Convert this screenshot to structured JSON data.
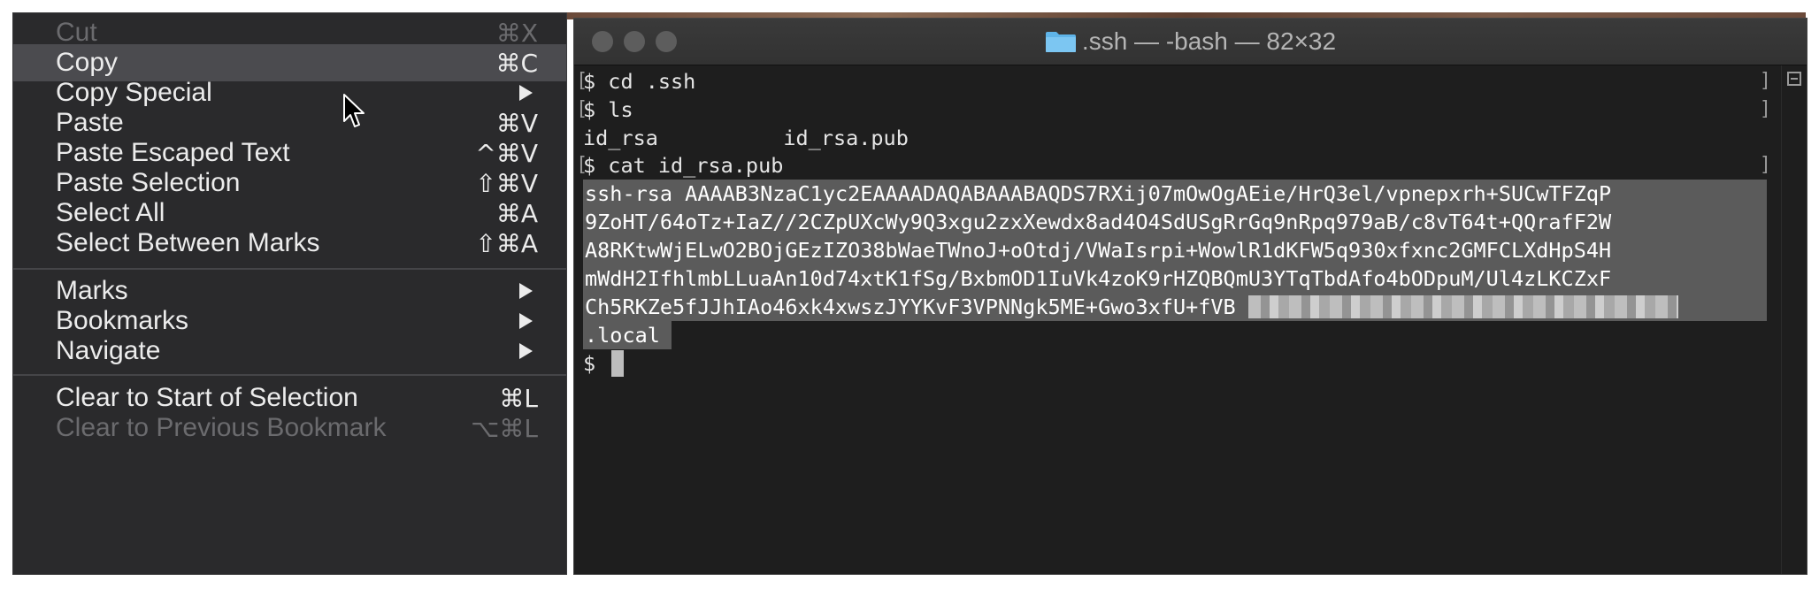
{
  "menu": {
    "items": [
      {
        "label": "Cut",
        "shortcut": "⌘X",
        "disabled": true
      },
      {
        "label": "Copy",
        "shortcut": "⌘C",
        "highlighted": true
      },
      {
        "label": "Copy Special",
        "submenu": true
      },
      {
        "label": "Paste",
        "shortcut": "⌘V"
      },
      {
        "label": "Paste Escaped Text",
        "shortcut": "^⌘V"
      },
      {
        "label": "Paste Selection",
        "shortcut": "⇧⌘V"
      },
      {
        "label": "Select All",
        "shortcut": "⌘A"
      },
      {
        "label": "Select Between Marks",
        "shortcut": "⇧⌘A"
      },
      {
        "label": "Marks",
        "submenu": true
      },
      {
        "label": "Bookmarks",
        "submenu": true
      },
      {
        "label": "Navigate",
        "submenu": true
      },
      {
        "label": "Clear to Start of Selection",
        "shortcut": "⌘L"
      },
      {
        "label": "Clear to Previous Bookmark",
        "shortcut": "⌥⌘L",
        "disabled": true
      }
    ]
  },
  "terminal": {
    "title": ".ssh — -bash — 82×32",
    "lines": {
      "l1": "$ cd .ssh",
      "l2": "$ ls",
      "l3": "id_rsa          id_rsa.pub",
      "l4": "$ cat id_rsa.pub",
      "k1": "ssh-rsa AAAAB3NzaC1yc2EAAAADAQABAAABAQDS7RXij07mOwOgAEie/HrQ3el/vpnepxrh+SUCwTFZqP",
      "k2": "9ZoHT/64oTz+IaZ//2CZpUXcWy9Q3xgu2zxXewdx8ad4O4SdUSgRrGq9nRpq979aB/c8vT64t+QQrafF2W",
      "k3": "A8RKtwWjELwO2BOjGEzIZO38bWaeTWnoJ+oOtdj/VWaIsrpi+WowlR1dKFW5q930xfxnc2GMFCLXdHpS4H",
      "k4": "mWdH2IfhlmbLLuaAn10d74xtK1fSg/BxbmOD1IuVk4zoK9rHZQBQmU3YTqTbdAfo4bODpuM/Ul4zLKCZxF",
      "k5": "Ch5RKZe5fJJhIAo46xk4xwszJYYKvF3VPNNgk5ME+Gwo3xfU+fVB",
      "k6": ".local",
      "prompt": "$ "
    },
    "marker_left": "[",
    "marker_right": "]"
  },
  "icons": {
    "folder": "folder-icon",
    "pointer": "mouse-pointer-icon",
    "split": "split-pane-icon"
  },
  "colors": {
    "menu_bg": "#2a2a2c",
    "menu_highlight": "#4b4b4f",
    "terminal_bg": "#1e1e1e",
    "selection": "#5b5b5b",
    "folder": "#5fb4e8"
  }
}
